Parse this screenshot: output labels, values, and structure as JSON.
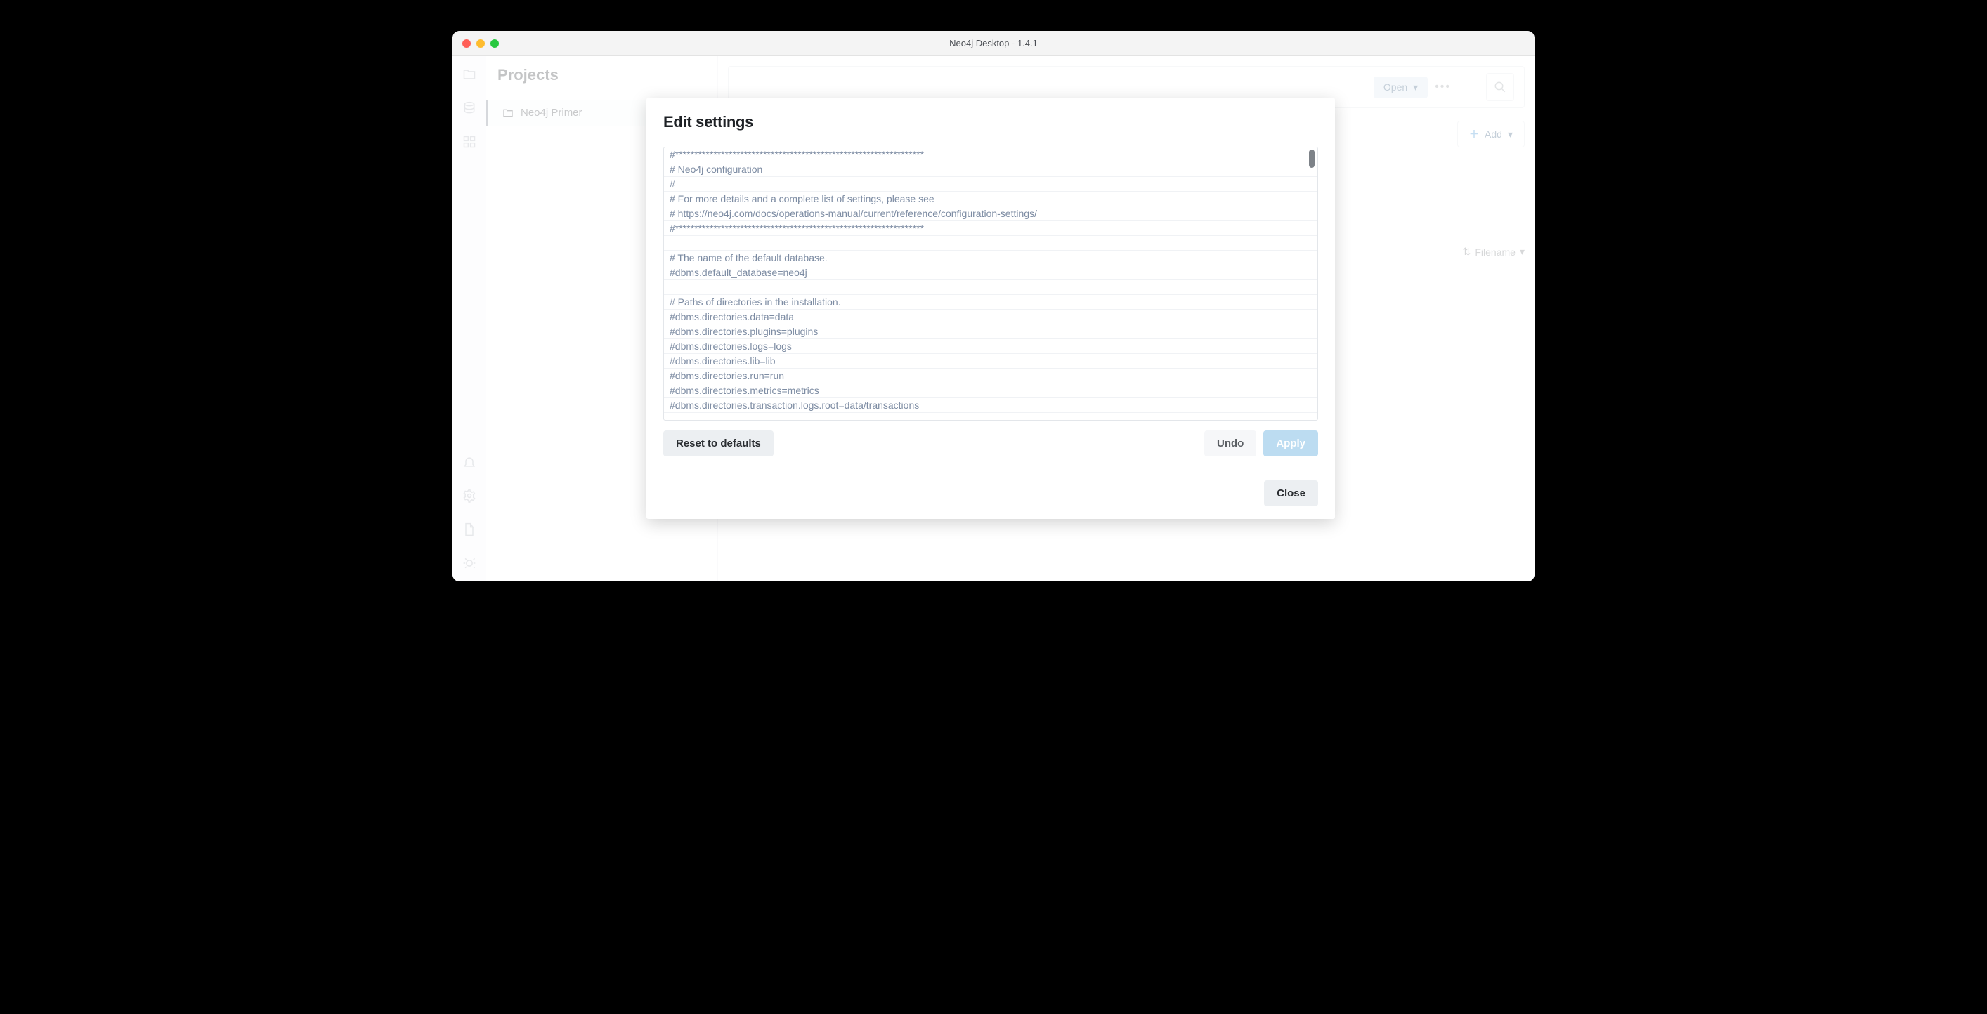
{
  "window": {
    "title": "Neo4j Desktop - 1.4.1"
  },
  "sidebar": {
    "projects_heading": "Projects",
    "project_item": "Neo4j Primer"
  },
  "header": {
    "open_label": "Open",
    "add_label": "Add",
    "filename_label": "Filename"
  },
  "modal": {
    "title": "Edit settings",
    "buttons": {
      "reset": "Reset to defaults",
      "undo": "Undo",
      "apply": "Apply",
      "close": "Close"
    },
    "lines": [
      "#*****************************************************************",
      "# Neo4j configuration",
      "#",
      "# For more details and a complete list of settings, please see",
      "# https://neo4j.com/docs/operations-manual/current/reference/configuration-settings/",
      "#*****************************************************************",
      "",
      "# The name of the default database.",
      "#dbms.default_database=neo4j",
      "",
      "# Paths of directories in the installation.",
      "#dbms.directories.data=data",
      "#dbms.directories.plugins=plugins",
      "#dbms.directories.logs=logs",
      "#dbms.directories.lib=lib",
      "#dbms.directories.run=run",
      "#dbms.directories.metrics=metrics",
      "#dbms.directories.transaction.logs.root=data/transactions"
    ]
  }
}
